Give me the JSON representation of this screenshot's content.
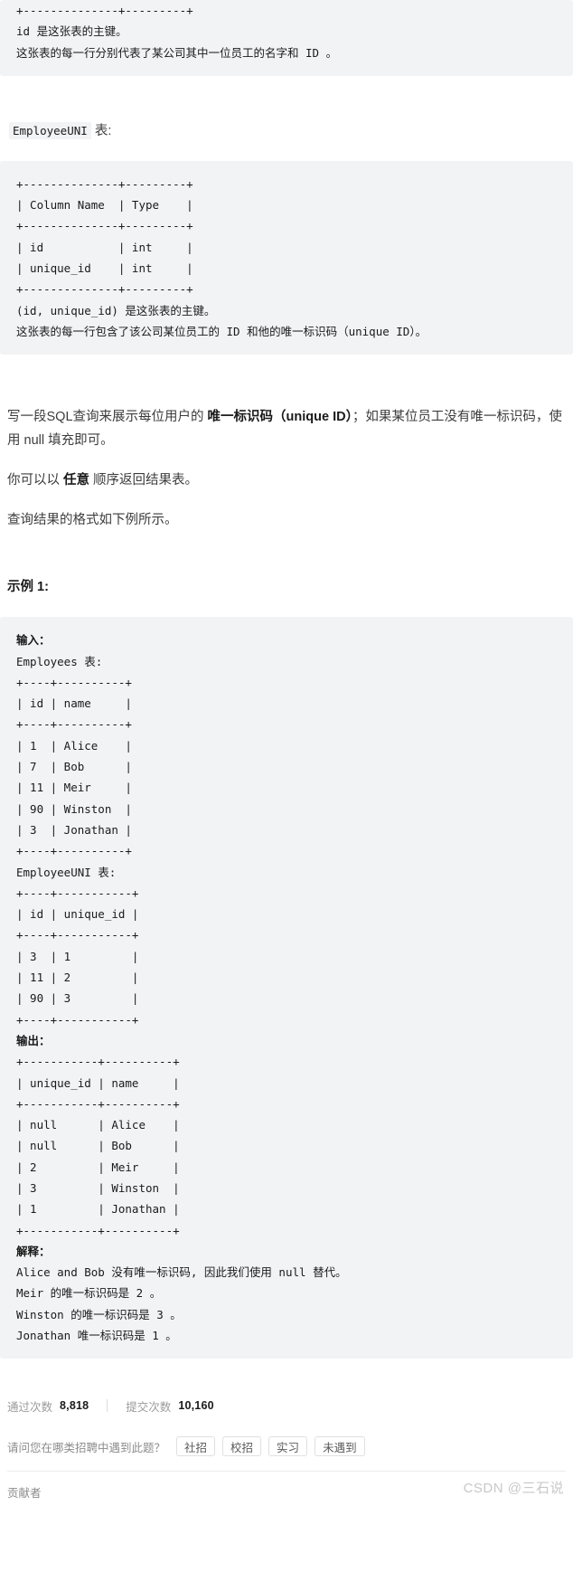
{
  "blocks": {
    "employees_schema_tail": "+--------------+---------+\nid 是这张表的主键。\n这张表的每一行分别代表了某公司其中一位员工的名字和 ID 。",
    "employeeuni_label_code": "EmployeeUNI",
    "employeeuni_label_suffix": "表:",
    "employeeuni_schema": "+--------------+---------+\n| Column Name  | Type    |\n+--------------+---------+\n| id           | int     |\n| unique_id    | int     |\n+--------------+---------+\n(id, unique_id) 是这张表的主键。\n这张表的每一行包含了该公司某位员工的 ID 和他的唯一标识码（unique ID）。"
  },
  "prompt": {
    "line1_a": "写一段SQL查询来展示每位用户的 ",
    "line1_bold": "唯一标识码（unique ID）",
    "line1_b": "；如果某位员工没有唯一标识码，使用 null 填充即可。",
    "line2_a": "你可以以 ",
    "line2_bold": "任意",
    "line2_b": " 顺序返回结果表。",
    "line3": "查询结果的格式如下例所示。"
  },
  "example": {
    "heading": "示例 1:",
    "input_label": "输入：",
    "employees_table": "Employees 表:\n+----+----------+\n| id | name     |\n+----+----------+\n| 1  | Alice    |\n| 7  | Bob      |\n| 11 | Meir     |\n| 90 | Winston  |\n| 3  | Jonathan |\n+----+----------+",
    "employeeuni_table": "EmployeeUNI 表:\n+----+-----------+\n| id | unique_id |\n+----+-----------+\n| 3  | 1         |\n| 11 | 2         |\n| 90 | 3         |\n+----+-----------+",
    "output_label": "输出：",
    "output_table": "+-----------+----------+\n| unique_id | name     |\n+-----------+----------+\n| null      | Alice    |\n| null      | Bob      |\n| 2         | Meir     |\n| 3         | Winston  |\n| 1         | Jonathan |\n+-----------+----------+",
    "explain_label": "解释：",
    "explain_body": "Alice and Bob 没有唯一标识码, 因此我们使用 null 替代。\nMeir 的唯一标识码是 2 。\nWinston 的唯一标识码是 3 。\nJonathan 唯一标识码是 1 。"
  },
  "stats": {
    "pass_label": "通过次数",
    "pass_value": "8,818",
    "submit_label": "提交次数",
    "submit_value": "10,160"
  },
  "recruit": {
    "question": "请问您在哪类招聘中遇到此题？",
    "tags": [
      "社招",
      "校招",
      "实习",
      "未遇到"
    ]
  },
  "contributor": {
    "label": "贡献者"
  },
  "watermark": {
    "text": "CSDN @三石说"
  },
  "colors": {
    "code_bg": "#f2f3f5",
    "text": "#3c3c3c",
    "muted": "#9b9b9b",
    "watermark": "#c8c8c8"
  }
}
